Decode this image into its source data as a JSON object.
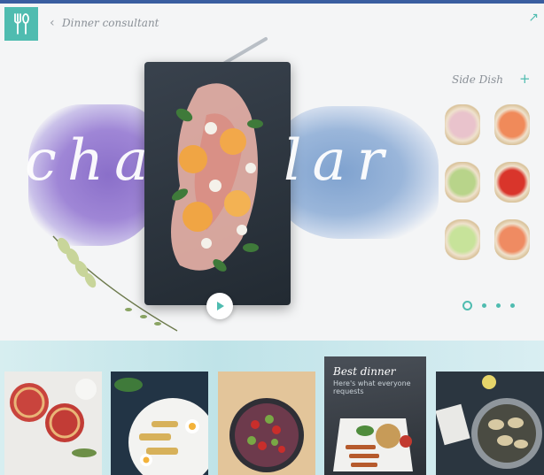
{
  "header": {
    "title": "Dinner consultant",
    "back_icon": "‹",
    "corner_icon": "↗"
  },
  "hero": {
    "script_left": "cha",
    "script_right": "lar",
    "play_icon": "play-icon"
  },
  "side_dish": {
    "label": "Side Dish",
    "add_icon": "+",
    "items": [
      {
        "name": "radish-toast",
        "color": "#e9c3cc"
      },
      {
        "name": "salmon-toast",
        "color": "#f08a5a"
      },
      {
        "name": "sprout-toast",
        "color": "#b8d48a"
      },
      {
        "name": "tomato-toast",
        "color": "#d9352b"
      },
      {
        "name": "cucumber-toast",
        "color": "#c7e39a"
      },
      {
        "name": "smoked-salmon-toast",
        "color": "#ef8b62"
      }
    ],
    "pagination": {
      "count": 4,
      "active": 0
    }
  },
  "bottom": {
    "camera_icon": "📷",
    "best_dinner": {
      "title": "Best dinner",
      "subtitle": "Here's what everyone requests"
    }
  },
  "colors": {
    "accent": "#4fbcb0",
    "topbar": "#3a5ea0"
  }
}
